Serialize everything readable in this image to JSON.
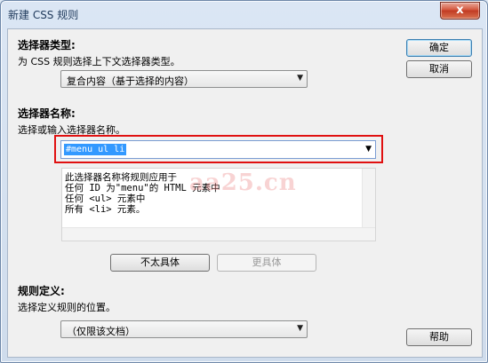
{
  "window": {
    "title": "新建 CSS 规则",
    "close_label": "x"
  },
  "selector_type": {
    "heading": "选择器类型:",
    "description": "为 CSS 规则选择上下文选择器类型。",
    "value": "复合内容（基于选择的内容）"
  },
  "selector_name": {
    "heading": "选择器名称:",
    "description": "选择或输入选择器名称。",
    "value": "#menu ul li",
    "explanation_lines": [
      "此选择器名称将规则应用于",
      "任何 ID 为\"menu\"的 HTML 元素中",
      "任何 <ul> 元素中",
      "所有 <li> 元素。"
    ],
    "less_specific_label": "不太具体",
    "more_specific_label": "更具体"
  },
  "rule_definition": {
    "heading": "规则定义:",
    "description": "选择定义规则的位置。",
    "value": "（仅限该文档）"
  },
  "buttons": {
    "ok": "确定",
    "cancel": "取消",
    "help": "帮助"
  },
  "watermark": "aa25.cn",
  "colors": {
    "highlight": "#e01010",
    "selection": "#3399ff"
  }
}
